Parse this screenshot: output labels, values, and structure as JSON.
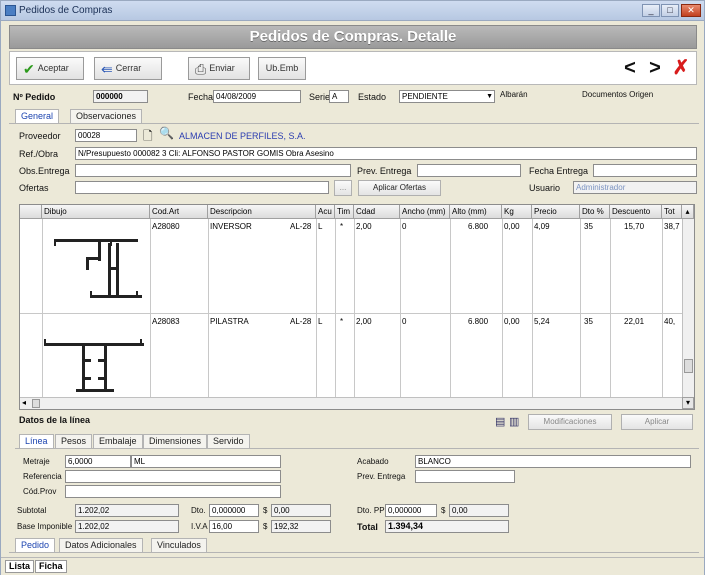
{
  "window": {
    "title": "Pedidos de Compras"
  },
  "banner": {
    "title": "Pedidos de Compras. Detalle"
  },
  "toolbar": {
    "accept": "Aceptar",
    "close": "Cerrar",
    "send": "Enviar",
    "ub_emb": "Ub.Emb"
  },
  "header": {
    "pedido_label": "Nº Pedido",
    "pedido": "000000",
    "fecha_label": "Fecha",
    "fecha": "04/08/2009",
    "serie_label": "Serie",
    "serie": "A",
    "estado_label": "Estado",
    "estado": "PENDIENTE",
    "albaran_label": "Albarán",
    "docs_label": "Documentos Origen"
  },
  "tabs_top": [
    "General",
    "Observaciones"
  ],
  "general": {
    "proveedor_label": "Proveedor",
    "proveedor_code": "00028",
    "proveedor_name": "ALMACEN DE PERFILES, S.A.",
    "ref_label": "Ref./Obra",
    "ref": "N/Presupuesto 000082 3 Cli: ALFONSO PASTOR GOMIS  Obra Asesino",
    "obs_entrega_label": "Obs.Entrega",
    "prev_entrega_label": "Prev. Entrega",
    "fecha_entrega_label": "Fecha Entrega",
    "ofertas_label": "Ofertas",
    "ellipsis": "...",
    "aplicar_label": "Aplicar Ofertas",
    "usuario_label": "Usuario",
    "usuario": "Administrador"
  },
  "lines": {
    "columns": [
      "Dibujo",
      "Cod.Art",
      "Descripcion",
      "Acu",
      "Tim",
      "Cdad",
      "Ancho (mm)",
      "Alto (mm)",
      "Kg",
      "Precio",
      "Dto %",
      "Descuento",
      "Tot"
    ],
    "rows": [
      {
        "cod": "A28080",
        "desc": "INVERSOR",
        "serie": "AL-28",
        "acu": "L",
        "tim": "*",
        "cdad": "2,00",
        "ancho": "0",
        "alto": "6.800",
        "kg": "0,00",
        "precio": "4,09",
        "dto": "35",
        "descuento": "15,70",
        "tot": "38,7"
      },
      {
        "cod": "A28083",
        "desc": "PILASTRA",
        "serie": "AL-28",
        "acu": "L",
        "tim": "*",
        "cdad": "2,00",
        "ancho": "0",
        "alto": "6.800",
        "kg": "0,00",
        "precio": "5,24",
        "dto": "35",
        "descuento": "22,01",
        "tot": "40,"
      }
    ]
  },
  "line_data": {
    "title": "Datos de la línea",
    "btn_modify": "Modificaciones",
    "btn_apply": "Aplicar",
    "tabs": [
      "Línea",
      "Pesos",
      "Embalaje",
      "Dimensiones",
      "Servido"
    ],
    "medida_label": "Metraje",
    "medida": "6,0000",
    "unit": "ML",
    "referencia_label": "Referencia",
    "codprov_label": "Cód.Prov",
    "acabado_label": "Acabado",
    "acabado": "BLANCO",
    "prev_entrega_label": "Prev. Entrega"
  },
  "totals": {
    "subtotal_label": "Subtotal",
    "subtotal": "1.202,02",
    "dto_label": "Dto.",
    "dto_pct": "0,000000",
    "dto_sym": "$",
    "dto_val": "0,00",
    "dtopp_label": "Dto. PP",
    "dtopp_pct": "0,000000",
    "dtopp_sym": "$",
    "dtopp_val": "0,00",
    "base_label": "Base Imponible",
    "base": "1.202,02",
    "iva_label": "I.V.A",
    "iva_pct": "16,00",
    "iva_sym": "$",
    "iva_val": "192,32",
    "total_label": "Total",
    "total": "1.394,34"
  },
  "bottom_tabs": [
    "Pedido",
    "Datos Adicionales",
    "Vinculados"
  ],
  "status_tabs": [
    "Lista",
    "Ficha"
  ]
}
